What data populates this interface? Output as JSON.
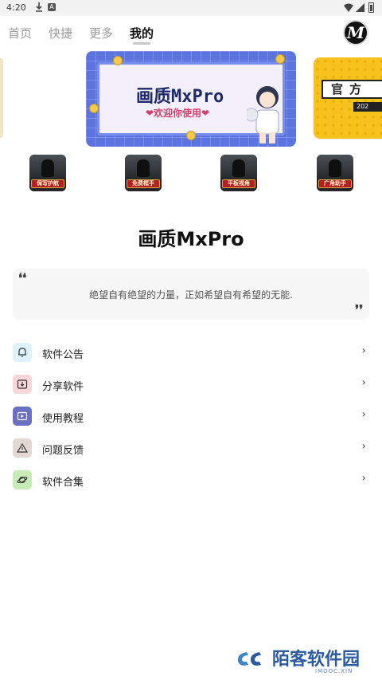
{
  "status_bar": {
    "time": "4:20",
    "a_label": "A"
  },
  "tabs": [
    {
      "label": "首页"
    },
    {
      "label": "快捷"
    },
    {
      "label": "更多"
    },
    {
      "label": "我的"
    }
  ],
  "active_tab": "我的",
  "logo": {
    "letter": "M"
  },
  "banner": {
    "title": "画质MxPro",
    "subtitle": "❤欢迎你使用❤"
  },
  "banner_next": {
    "tag": "官方",
    "year": "202"
  },
  "features": [
    {
      "label": "保写护航"
    },
    {
      "label": "免费框手"
    },
    {
      "label": "平板视角"
    },
    {
      "label": "广角助手"
    }
  ],
  "app_name": "画质MxPro",
  "quote": {
    "open_mark": "❛❛",
    "text": "绝望自有绝望的力量，正如希望自有希望的无能.",
    "close_mark": "❜❜"
  },
  "menu": [
    {
      "label": "软件公告",
      "icon": "bell-icon",
      "bg": "#dff1fb"
    },
    {
      "label": "分享软件",
      "icon": "share-download-icon",
      "bg": "#f9d6da"
    },
    {
      "label": "使用教程",
      "icon": "video-play-icon",
      "bg": "#6c70c4"
    },
    {
      "label": "问题反馈",
      "icon": "warning-icon",
      "bg": "#e3d8d4"
    },
    {
      "label": "软件合集",
      "icon": "planet-icon",
      "bg": "#c8ecb8"
    }
  ],
  "chevron": "›",
  "watermark": {
    "text": "陌客软件园",
    "sub": "IMOOC.XIN"
  }
}
